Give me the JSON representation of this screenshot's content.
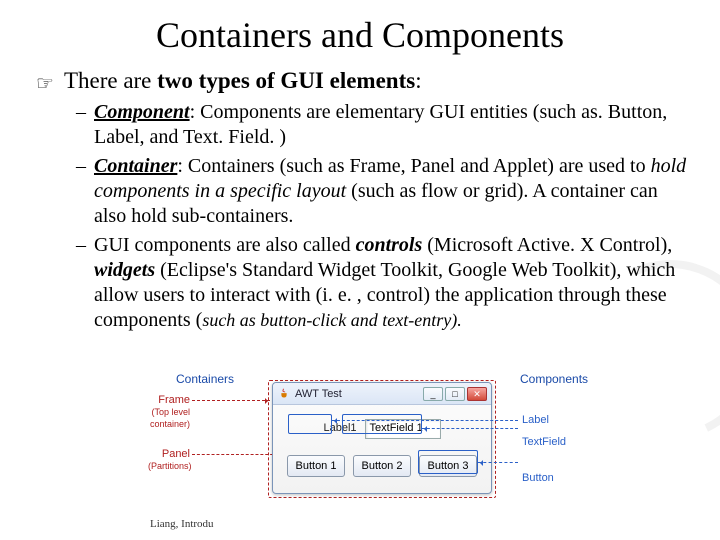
{
  "title": "Containers and Components",
  "bullet_icon": "☞",
  "main_bullet": {
    "lead": "There are ",
    "bold": "two types of GUI elements",
    "tail": ":"
  },
  "subs": [
    {
      "term": "Component",
      "after_term": ": Components are elementary GUI entities (such as. Button, Label, and Text. Field. )"
    },
    {
      "term": "Container",
      "after_term_a": ": Containers (such as Frame, Panel and Applet) are used to ",
      "italic_mid": "hold components in a specific layout",
      "after_term_b": " (such as flow or grid). A container can also hold sub-containers."
    },
    {
      "plain_a": "GUI components are also called ",
      "it1": "controls",
      "plain_b": " (Microsoft Active. X Control), ",
      "it2": "widgets",
      "plain_c": " (Eclipse's Standard Widget Toolkit, Google Web Toolkit), which allow users to interact with (i. e. , control) the application through these components (",
      "small_it": "such as button-click and text-entry).",
      "plain_d": ""
    }
  ],
  "diagram": {
    "left_header": "Containers",
    "right_header": "Components",
    "frame_label": "Frame",
    "frame_sub": "(Top level container)",
    "panel_label": "Panel",
    "panel_sub": "(Partitions)",
    "label_right": "Label",
    "textfield_right": "TextField",
    "button_right": "Button",
    "awt": {
      "title": "AWT Test",
      "label1": "Label1",
      "tf_value": "TextField 1",
      "b1": "Button 1",
      "b2": "Button 2",
      "b3": "Button 3",
      "min": "_",
      "max": "□",
      "close": "✕"
    }
  },
  "footer": "Liang, Introdu"
}
